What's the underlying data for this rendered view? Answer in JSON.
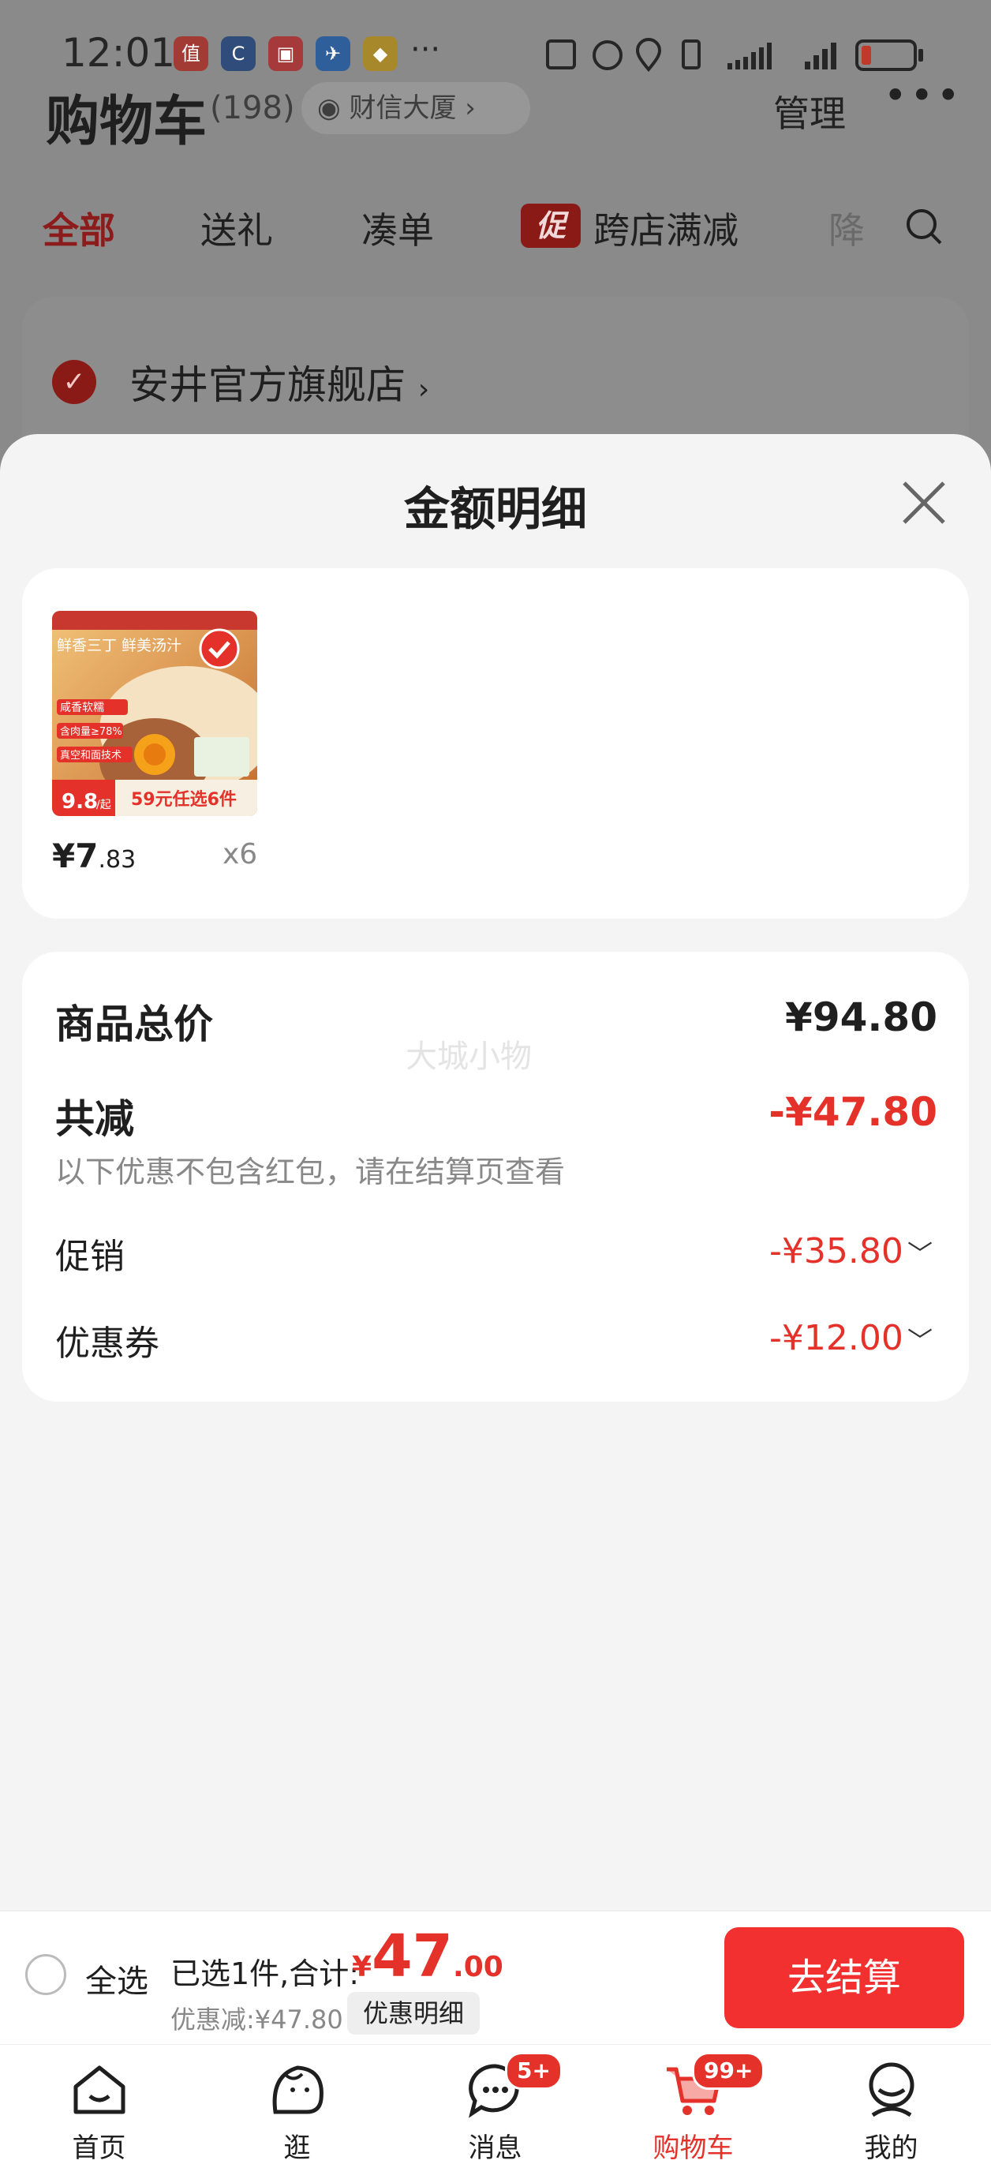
{
  "status_bar": {
    "time": "12:01",
    "app_icons": [
      "值",
      "C",
      "▣",
      "✈",
      "◆"
    ],
    "overflow": "···"
  },
  "cart_header": {
    "title": "购物车",
    "count": "(198)",
    "address": "财信大厦",
    "manage": "管理",
    "more": "•••"
  },
  "tabs": [
    "全部",
    "送礼",
    "凑单",
    "跨店满减",
    "降"
  ],
  "promo_tag": "促",
  "store": {
    "name": "安井官方旗舰店",
    "chevron": "›"
  },
  "sheet": {
    "title": "金额明细",
    "item": {
      "price_main": "¥7",
      "price_decimal": ".83",
      "quantity": "x6",
      "thumb_texts": {
        "headline": "鲜香三丁 鲜美汤汁",
        "tag1": "咸香软糯",
        "tag2": "含肉量≥78%",
        "tag3": "真空和面技术",
        "price": "9.8",
        "price_suffix": "/起",
        "banner": "59元任选6件"
      }
    },
    "summary": {
      "total_label": "商品总价",
      "total_value": "¥94.80",
      "watermark": "大城小物",
      "reduce_label": "共减",
      "reduce_value": "-¥47.80",
      "note": "以下优惠不包含红包，请在结算页查看",
      "rows": [
        {
          "label": "促销",
          "value": "-¥35.80"
        },
        {
          "label": "优惠券",
          "value": "-¥12.00"
        }
      ]
    }
  },
  "bottom_bar": {
    "select_all": "全选",
    "selected_text": "已选1件,合计:",
    "currency": "¥",
    "total_main": "47",
    "total_decimal": ".00",
    "discount_text": "优惠减:¥47.80",
    "detail_button": "优惠明细",
    "checkout": "去结算"
  },
  "tabbar": [
    {
      "label": "首页",
      "icon": "home-icon"
    },
    {
      "label": "逛",
      "icon": "browse-icon"
    },
    {
      "label": "消息",
      "icon": "message-icon",
      "badge": "5+"
    },
    {
      "label": "购物车",
      "icon": "cart-icon",
      "badge": "99+"
    },
    {
      "label": "我的",
      "icon": "profile-icon"
    }
  ],
  "colors": {
    "accent": "#e4322b",
    "checkout": "#f23030",
    "overlay": "#8a8a8a"
  }
}
